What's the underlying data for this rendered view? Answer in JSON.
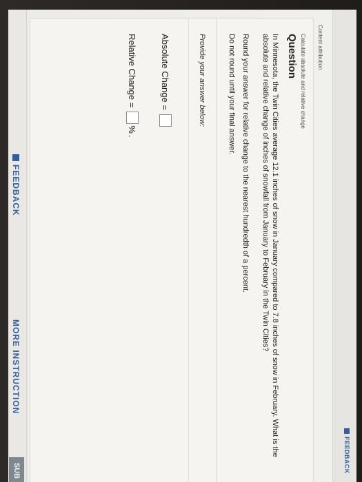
{
  "header": {
    "feedback_label": "FEEDBACK"
  },
  "content_attribution": "Content attribution",
  "question": {
    "subtitle": "Calculate absolute and relative change",
    "title": "Question",
    "text": "In Minnesota, the Twin Cities average 12.1 inches of snow in January compared to 7.8 inches of snow in February. What is the absolute and relative change of inches of snowfall from January to February in the Twin Cities?",
    "instruction_round": "Round your answer for relative change to the nearest hundredth of a percent.",
    "instruction_no_round": "Do not round until your final answer."
  },
  "answer": {
    "prompt": "Provide your answer below:",
    "absolute_label": "Absolute Change =",
    "relative_label": "Relative Change =",
    "percent_sign": "%",
    "trailing_period": "."
  },
  "footer": {
    "feedback_label": "FEEDBACK",
    "more_instruction_label": "MORE INSTRUCTION",
    "submit_label": "SUB"
  },
  "colors": {
    "link_blue": "#2f5f9e",
    "submit_gray": "#7d8891",
    "background": "#f1f0ed"
  },
  "icons": {
    "feedback": "feedback-square-icon"
  }
}
